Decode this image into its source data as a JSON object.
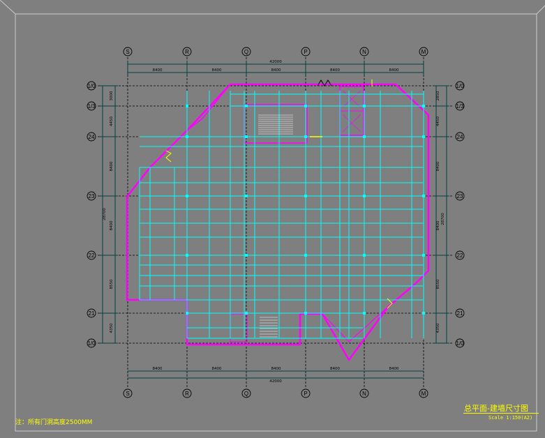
{
  "drawing": {
    "title": "总平面-建墙尺寸图",
    "scale": "Scale   1:150(A2)",
    "note": "注：所有门洞高度2500MM",
    "total_width": "42000",
    "total_depth": "28700",
    "grid_columns": [
      "S",
      "R",
      "Q",
      "P",
      "N",
      "M"
    ],
    "grid_rows": [
      "1/0",
      "1/3",
      "24",
      "23",
      "22",
      "21",
      "1/0"
    ],
    "column_spacings": [
      "8400",
      "8400",
      "8400",
      "8400",
      "8400"
    ],
    "row_spacings": [
      "3000",
      "4450",
      "8400",
      "8400",
      "8550",
      "4350"
    ],
    "row_spacings_right": [
      "2850",
      "4450",
      "8400",
      "8400",
      "8550",
      "4350"
    ]
  },
  "colors": {
    "background": "#7f7f7f",
    "grid": "#000000",
    "walls": "#ff00ff",
    "structure": "#00ffff",
    "annotation": "#ffff00",
    "dimension": "#004040"
  }
}
